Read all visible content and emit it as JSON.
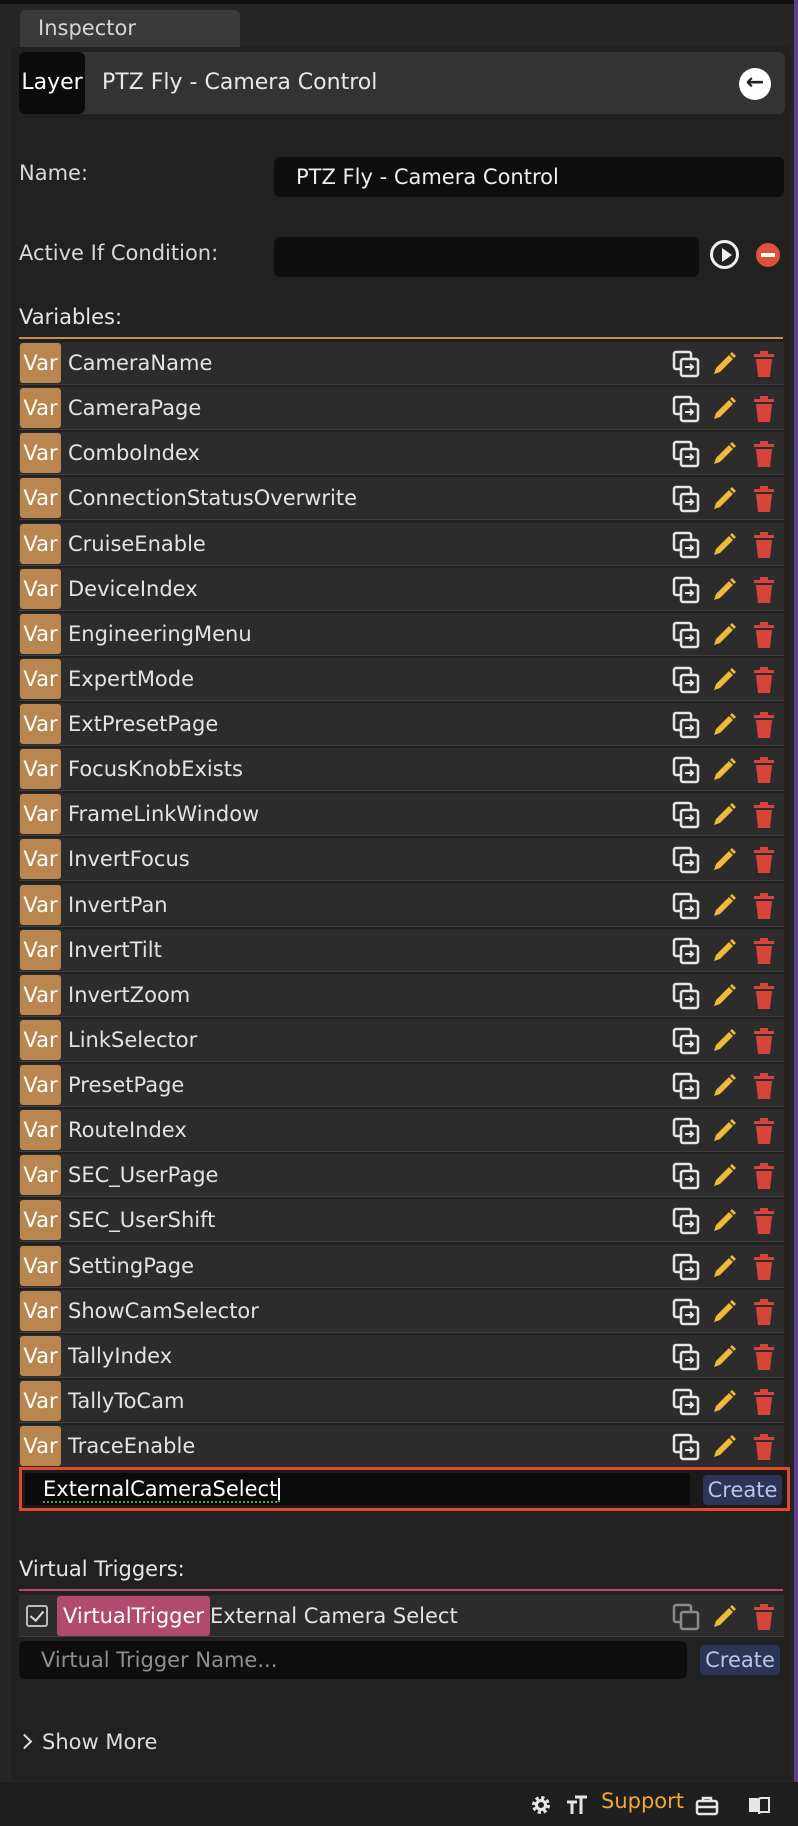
{
  "inspector": {
    "tab_label": "Inspector"
  },
  "layer": {
    "badge": "Layer",
    "title": "PTZ Fly - Camera Control"
  },
  "name_field": {
    "label": "Name:",
    "value": "PTZ Fly - Camera Control"
  },
  "active_if": {
    "label": "Active If Condition:",
    "value": ""
  },
  "variables": {
    "title": "Variables:",
    "badge": "Var",
    "items": [
      "CameraName",
      "CameraPage",
      "ComboIndex",
      "ConnectionStatusOverwrite",
      "CruiseEnable",
      "DeviceIndex",
      "EngineeringMenu",
      "ExpertMode",
      "ExtPresetPage",
      "FocusKnobExists",
      "FrameLinkWindow",
      "InvertFocus",
      "InvertPan",
      "InvertTilt",
      "InvertZoom",
      "LinkSelector",
      "PresetPage",
      "RouteIndex",
      "SEC_UserPage",
      "SEC_UserShift",
      "SettingPage",
      "ShowCamSelector",
      "TallyIndex",
      "TallyToCam",
      "TraceEnable"
    ],
    "new_input_value": "ExternalCameraSelect",
    "create_label": "Create"
  },
  "virtual_triggers": {
    "title": "Virtual Triggers:",
    "badge": "VirtualTrigger",
    "item_name": "External Camera Select",
    "checked": true,
    "input_placeholder": "Virtual Trigger Name...",
    "create_label": "Create"
  },
  "show_more": "Show More",
  "footer": {
    "support": "Support"
  },
  "colors": {
    "var_badge": "#b8864e",
    "vt_badge": "#b04b6f",
    "edit_icon": "#f0b93a",
    "delete_icon": "#d6443a",
    "highlight_border": "#e04a2b",
    "support_text": "#f0a63a",
    "variables_divider": "#c8904e",
    "triggers_divider": "#b04b6f"
  }
}
